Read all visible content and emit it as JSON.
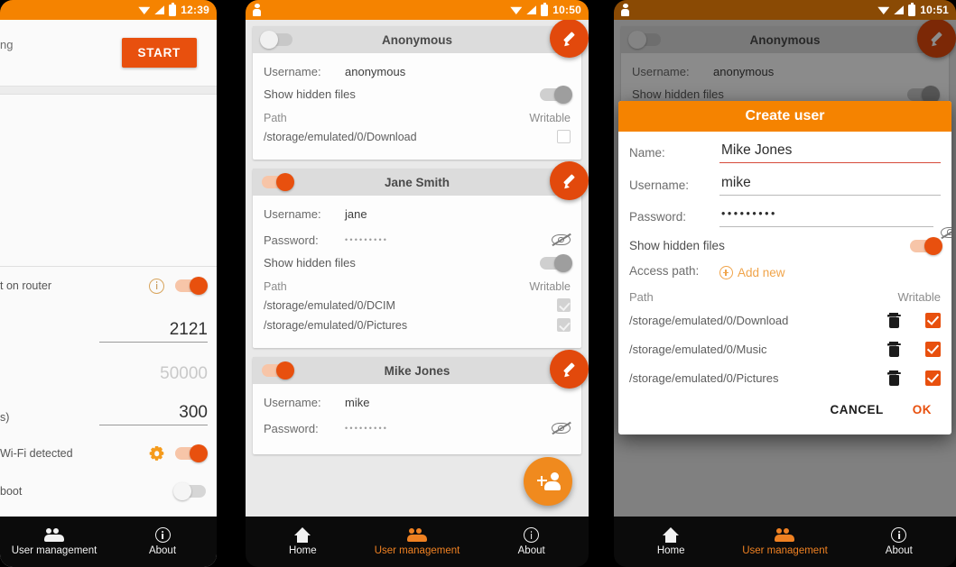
{
  "panels": {
    "left": {
      "status": {
        "time": "12:39",
        "wifi_icon": "wifi-icon",
        "signal_icon": "signal-icon",
        "battery_icon": "battery-icon"
      },
      "server_row": {
        "label_partial": "ng",
        "start_button": "START"
      },
      "settings": {
        "port_on_router": {
          "label_partial": "t on router",
          "info_icon": "info-circle-icon",
          "toggle": "on"
        },
        "port_value": "2121",
        "port_placeholder": "50000",
        "timeout": {
          "label_partial": "s)",
          "value": "300"
        },
        "wifi_detected": {
          "label_partial": "Wi-Fi detected",
          "gear_icon": "gear-icon",
          "toggle": "on"
        },
        "on_boot": {
          "label_partial": "boot",
          "toggle": "off"
        }
      },
      "nav": [
        {
          "label": "User management",
          "icon": "people-icon",
          "active": false
        },
        {
          "label": "About",
          "icon": "info-icon",
          "active": false
        }
      ]
    },
    "middle": {
      "status": {
        "time": "10:50",
        "app_icon": "person-icon"
      },
      "cards": [
        {
          "title": "Anonymous",
          "enabled": false,
          "edit_icon": "pencil-icon",
          "username_label": "Username:",
          "username_value": "anonymous",
          "has_password": false,
          "show_hidden_label": "Show hidden files",
          "show_hidden": false,
          "path_header": "Path",
          "writable_header": "Writable",
          "paths": [
            {
              "path": "/storage/emulated/0/Download",
              "writable": false
            }
          ]
        },
        {
          "title": "Jane Smith",
          "enabled": true,
          "edit_icon": "pencil-icon",
          "username_label": "Username:",
          "username_value": "jane",
          "has_password": true,
          "password_label": "Password:",
          "password_value": "•••••••••",
          "password_eye_icon": "eye-off-icon",
          "show_hidden_label": "Show hidden files",
          "show_hidden": true,
          "path_header": "Path",
          "writable_header": "Writable",
          "paths": [
            {
              "path": "/storage/emulated/0/DCIM",
              "writable": true
            },
            {
              "path": "/storage/emulated/0/Pictures",
              "writable": true
            }
          ]
        },
        {
          "title": "Mike Jones",
          "enabled": true,
          "edit_icon": "pencil-icon",
          "username_label": "Username:",
          "username_value": "mike",
          "has_password": true,
          "password_label": "Password:",
          "password_value": "•••••••••",
          "password_eye_icon": "eye-off-icon"
        }
      ],
      "fab_add": {
        "icon": "add-person-icon"
      },
      "nav": [
        {
          "label": "Home",
          "icon": "home-icon",
          "active": false
        },
        {
          "label": "User management",
          "icon": "people-icon",
          "active": true
        },
        {
          "label": "About",
          "icon": "info-icon",
          "active": false
        }
      ]
    },
    "right": {
      "status": {
        "time": "10:51",
        "app_icon": "person-icon"
      },
      "background_card": {
        "title": "Anonymous",
        "username_label": "Username:",
        "username_value": "anonymous",
        "show_hidden_label": "Show hidden files"
      },
      "dialog": {
        "title": "Create user",
        "fields": [
          {
            "label": "Name:",
            "value": "Mike Jones",
            "error": true
          },
          {
            "label": "Username:",
            "value": "mike",
            "error": false
          },
          {
            "label": "Password:",
            "value": "•••••••••",
            "error": false,
            "eye_icon": "eye-off-icon"
          }
        ],
        "show_hidden_label": "Show hidden files",
        "show_hidden": true,
        "access_path_label": "Access path:",
        "add_new_label": "Add new",
        "add_new_icon": "plus-circle-icon",
        "path_header": "Path",
        "writable_header": "Writable",
        "paths": [
          {
            "path": "/storage/emulated/0/Download",
            "writable": true,
            "delete_icon": "trash-icon"
          },
          {
            "path": "/storage/emulated/0/Music",
            "writable": true,
            "delete_icon": "trash-icon"
          },
          {
            "path": "/storage/emulated/0/Pictures",
            "writable": true,
            "delete_icon": "trash-icon"
          }
        ],
        "cancel_label": "CANCEL",
        "ok_label": "OK"
      },
      "nav": [
        {
          "label": "Home",
          "icon": "home-icon",
          "active": false
        },
        {
          "label": "User management",
          "icon": "people-icon",
          "active": true
        },
        {
          "label": "About",
          "icon": "info-icon",
          "active": false
        }
      ]
    }
  },
  "colors": {
    "status_orange": "#F58300",
    "accent_orange": "#E8500E",
    "fab_orange": "#F08A1E",
    "nav_active": "#EF8122",
    "error_red": "#D64A3B"
  }
}
